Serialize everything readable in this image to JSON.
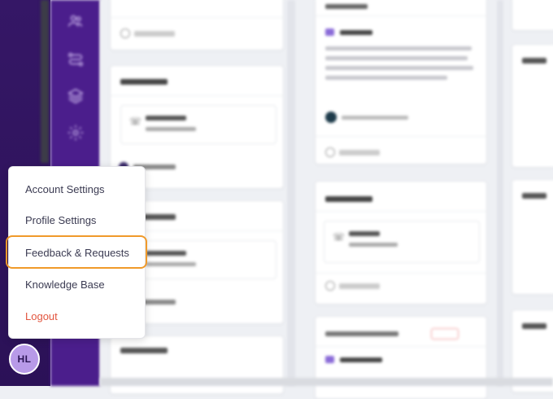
{
  "user": {
    "initials": "HL"
  },
  "menu": {
    "items": [
      {
        "id": "account",
        "label": "Account Settings"
      },
      {
        "id": "profile",
        "label": "Profile Settings"
      },
      {
        "id": "feedback",
        "label": "Feedback & Requests",
        "highlighted": true
      },
      {
        "id": "knowledge",
        "label": "Knowledge Base"
      },
      {
        "id": "logout",
        "label": "Logout"
      }
    ]
  },
  "nav": {
    "icons": [
      "people-icon",
      "workflow-icon",
      "layers-icon",
      "gear-icon"
    ]
  },
  "colors": {
    "rail": "#351766",
    "nav": "#4b1e8c",
    "highlight": "#f09a2a",
    "logout": "#e2553f",
    "avatar": "#b89ae8"
  }
}
